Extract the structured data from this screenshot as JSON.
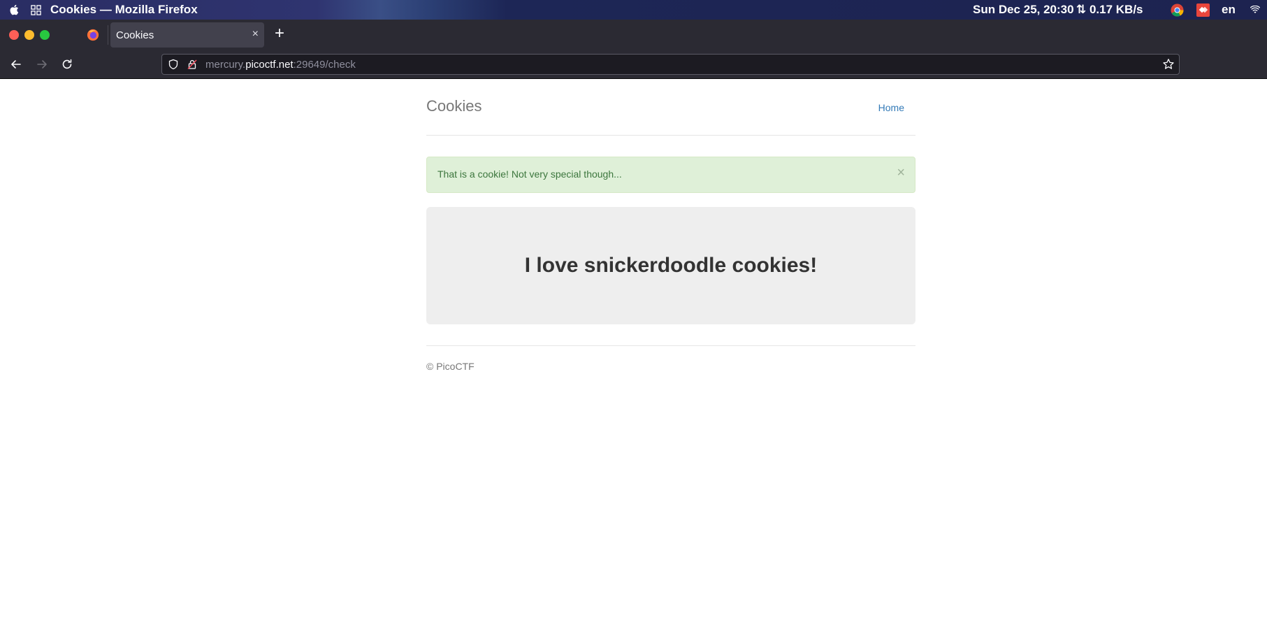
{
  "os_bar": {
    "window_title": "Cookies — Mozilla Firefox",
    "clock": "Sun Dec 25, 20:30",
    "network": "⇅ 0.17 KB/s",
    "language": "en"
  },
  "browser": {
    "tab": {
      "title": "Cookies",
      "close_glyph": "×"
    },
    "new_tab_glyph": "+",
    "url": {
      "prefix": "mercury.",
      "host": "picoctf.net",
      "suffix": ":29649/check"
    }
  },
  "page": {
    "brand": "Cookies",
    "nav": {
      "home_label": "Home"
    },
    "alert": {
      "message": "That is a cookie! Not very special though...",
      "close_glyph": "×",
      "color": "#3c763d"
    },
    "jumbotron": {
      "heading": "I love snickerdoodle cookies!"
    },
    "footer": "© PicoCTF"
  },
  "colors": {
    "link": "#337ab7",
    "alert_bg": "#dff0d8",
    "jumbotron_bg": "#eeeeee",
    "chrome_bg": "#2b2a33"
  }
}
